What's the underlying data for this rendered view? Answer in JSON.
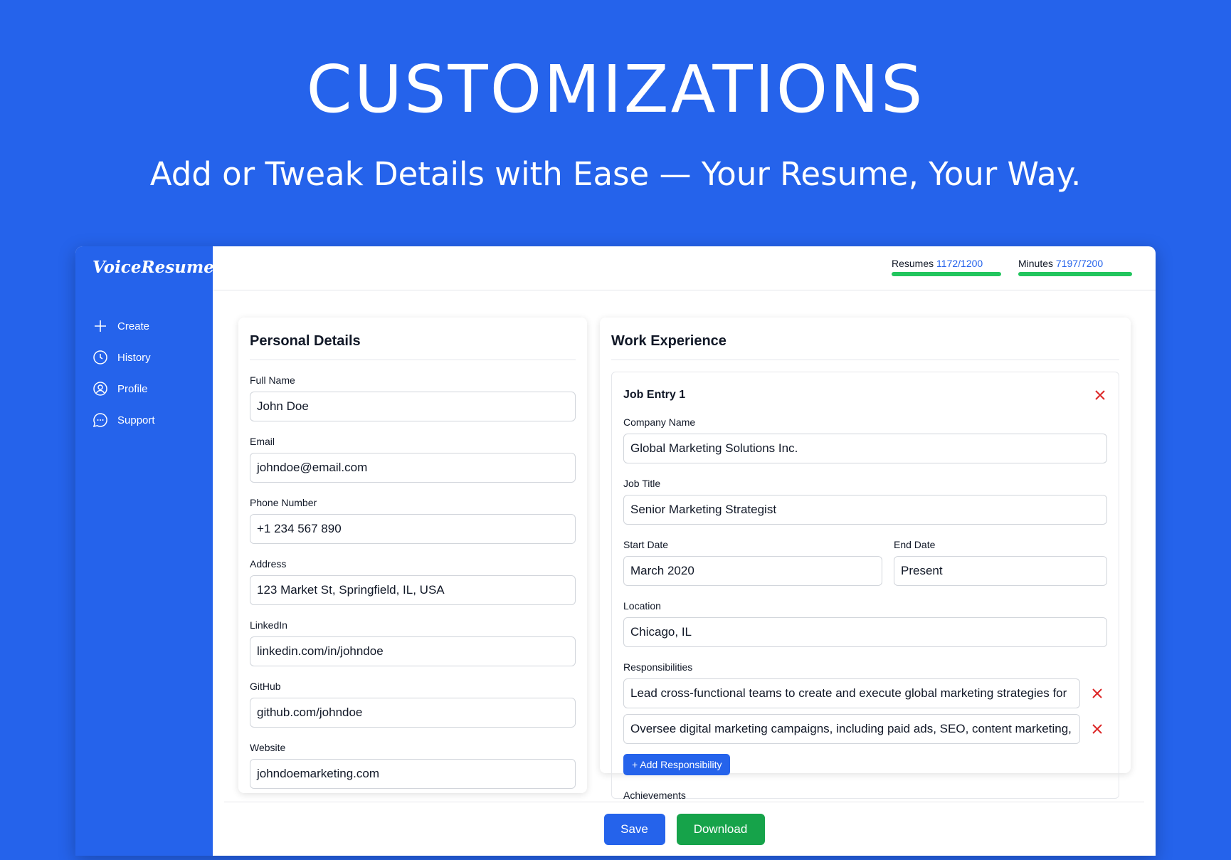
{
  "hero": {
    "title": "CUSTOMIZATIONS",
    "subtitle": "Add or Tweak Details with Ease — Your Resume, Your Way."
  },
  "sidebar": {
    "logo": "VoiceResume",
    "items": [
      {
        "label": "Create",
        "icon": "plus-icon"
      },
      {
        "label": "History",
        "icon": "clock-icon"
      },
      {
        "label": "Profile",
        "icon": "user-circle-icon"
      },
      {
        "label": "Support",
        "icon": "chat-bubble-icon"
      }
    ]
  },
  "usage": {
    "resumes": {
      "label": "Resumes",
      "value": "1172/1200",
      "used": 1172,
      "total": 1200
    },
    "minutes": {
      "label": "Minutes",
      "value": "7197/7200",
      "used": 7197,
      "total": 7200
    }
  },
  "personal": {
    "title": "Personal Details",
    "fields": [
      {
        "label": "Full Name",
        "value": "John Doe"
      },
      {
        "label": "Email",
        "value": "johndoe@email.com"
      },
      {
        "label": "Phone Number",
        "value": "+1 234 567 890"
      },
      {
        "label": "Address",
        "value": "123 Market St, Springfield, IL, USA"
      },
      {
        "label": "LinkedIn",
        "value": "linkedin.com/in/johndoe"
      },
      {
        "label": "GitHub",
        "value": "github.com/johndoe"
      },
      {
        "label": "Website",
        "value": "johndoemarketing.com"
      }
    ]
  },
  "work": {
    "title": "Work Experience",
    "job": {
      "title": "Job Entry 1",
      "company_label": "Company Name",
      "company": "Global Marketing Solutions Inc.",
      "job_title_label": "Job Title",
      "job_title": "Senior Marketing Strategist",
      "start_label": "Start Date",
      "start": "March 2020",
      "end_label": "End Date",
      "end": "Present",
      "location_label": "Location",
      "location": "Chicago, IL",
      "responsibilities_label": "Responsibilities",
      "responsibilities": [
        "Lead cross-functional teams to create and execute global marketing strategies for",
        "Oversee digital marketing campaigns, including paid ads, SEO, content marketing,"
      ],
      "add_responsibility": "+ Add Responsibility",
      "achievements_label": "Achievements"
    }
  },
  "footer": {
    "save": "Save",
    "download": "Download"
  },
  "colors": {
    "brand": "#2563eb",
    "success": "#16a34a",
    "danger": "#dc2626"
  }
}
